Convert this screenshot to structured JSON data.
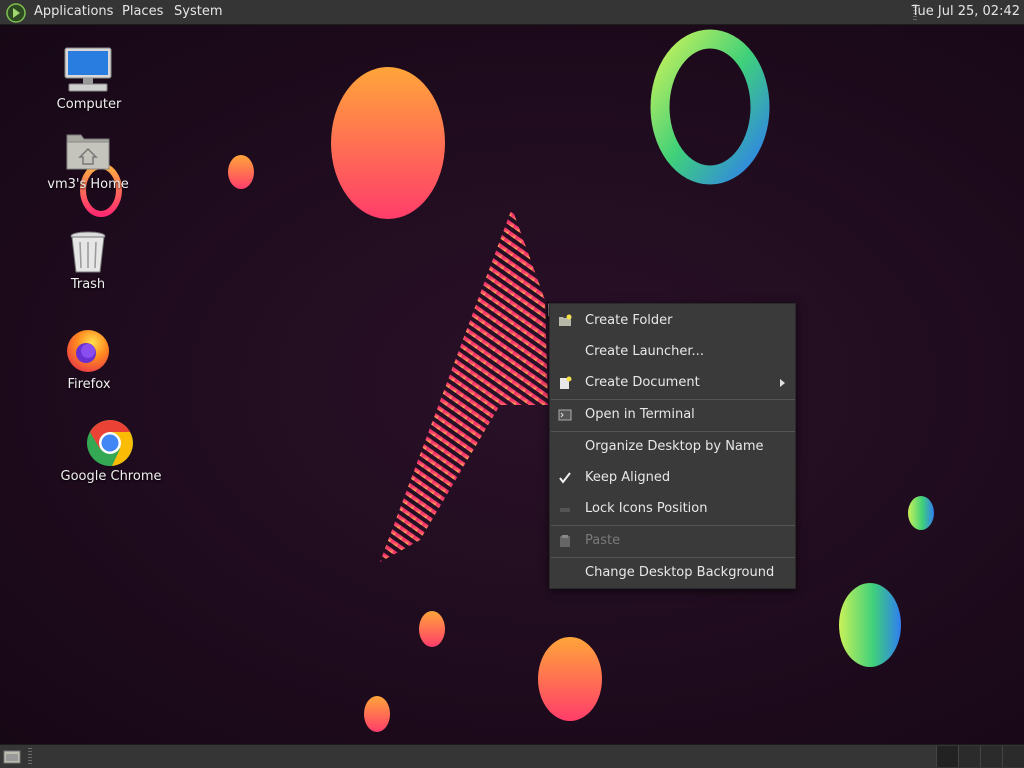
{
  "top_panel": {
    "menus": [
      "Applications",
      "Places",
      "System"
    ],
    "clock": "Tue Jul 25, 02:42"
  },
  "desktop": {
    "icons": [
      {
        "label": "Computer"
      },
      {
        "label": "vm3's Home"
      },
      {
        "label": "Trash"
      },
      {
        "label": "Firefox"
      },
      {
        "label": "Google Chrome"
      }
    ]
  },
  "context_menu": {
    "items": [
      {
        "label": "Create Folder",
        "icon": "folder-new-icon"
      },
      {
        "label": "Create Launcher..."
      },
      {
        "label": "Create Document",
        "icon": "document-new-icon",
        "submenu": true
      },
      {
        "label": "Open in Terminal",
        "icon": "terminal-icon"
      },
      {
        "label": "Organize Desktop by Name"
      },
      {
        "label": "Keep Aligned",
        "checked": true
      },
      {
        "label": "Lock Icons Position",
        "icon": "lock-icon"
      },
      {
        "label": "Paste",
        "icon": "paste-icon",
        "disabled": true
      },
      {
        "label": "Change Desktop Background"
      }
    ]
  },
  "colors": {
    "panel_bg": "#353535",
    "menu_bg": "#3a3a3a",
    "desktop_bg": "#1f0c1e"
  }
}
